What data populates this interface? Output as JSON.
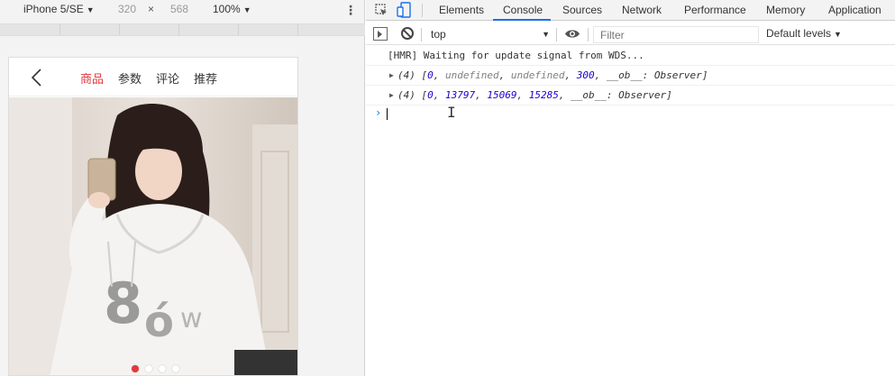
{
  "device_toolbar": {
    "device": "iPhone 5/SE",
    "width": "320",
    "times": "×",
    "height": "568",
    "zoom": "100%",
    "more": "⋮"
  },
  "phone": {
    "tabs": [
      {
        "label": "商品",
        "active": true
      },
      {
        "label": "参数",
        "active": false
      },
      {
        "label": "评论",
        "active": false
      },
      {
        "label": "推荐",
        "active": false
      }
    ],
    "carousel": {
      "count": 4,
      "active_index": 0
    },
    "colors": {
      "accent": "#e4393c"
    }
  },
  "devtools": {
    "tabs": [
      "Elements",
      "Console",
      "Sources",
      "Network",
      "Performance",
      "Memory",
      "Application"
    ],
    "active_tab": "Console",
    "console_toolbar": {
      "context": "top",
      "filter_placeholder": "Filter",
      "levels": "Default levels"
    },
    "messages": [
      {
        "text": "[HMR] Waiting for update signal from WDS..."
      },
      {
        "count": "(4)",
        "items": [
          "0",
          "undefined",
          "undefined",
          "300",
          "__ob__: Observer"
        ]
      },
      {
        "count": "(4)",
        "items": [
          "0",
          "13797",
          "15069",
          "15285",
          "__ob__: Observer"
        ]
      }
    ],
    "prompt": "›",
    "colors": {
      "accent": "#1a73e8",
      "number": "#1c00cf"
    }
  }
}
